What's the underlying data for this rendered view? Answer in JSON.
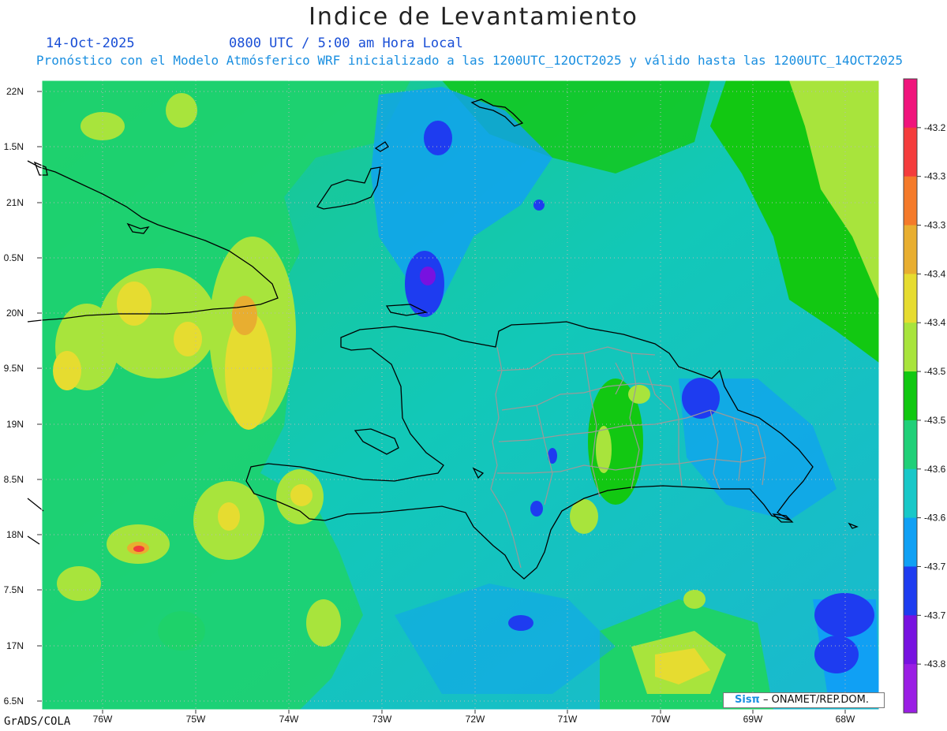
{
  "header": {
    "title": "Indice de Levantamiento",
    "date": "14-Oct-2025",
    "time": "0800 UTC / 5:00 am Hora Local",
    "forecast": "Pronóstico con el Modelo Atmósferico WRF inicializado a las 1200UTC_12OCT2025 y válido hasta las  1200UTC_14OCT2025"
  },
  "axes": {
    "lat_labels": [
      "22N",
      "1.5N",
      "21N",
      "0.5N",
      "20N",
      "9.5N",
      "19N",
      "8.5N",
      "18N",
      "7.5N",
      "17N",
      "6.5N"
    ],
    "lon_labels": [
      "76W",
      "75W",
      "74W",
      "73W",
      "72W",
      "71W",
      "70W",
      "69W",
      "68W"
    ]
  },
  "colorbar": {
    "labels": [
      "-43.2",
      "-43.3",
      "-43.3",
      "-43.4",
      "-43.4",
      "-43.5",
      "-43.5",
      "-43.6",
      "-43.6",
      "-43.7",
      "-43.7",
      "-43.8"
    ],
    "colors": [
      "#f0147c",
      "#f43c3c",
      "#f47a2a",
      "#e8ae30",
      "#e6dc30",
      "#a8e43c",
      "#10c810",
      "#20d078",
      "#18c8c8",
      "#10a0f4",
      "#1e3cf0",
      "#7812e0",
      "#9a1ee4"
    ]
  },
  "credit": {
    "brand": "Sisπ",
    "text": "– ONAMET/REP.DOM."
  },
  "footer": {
    "software": "GrADS/COLA"
  }
}
